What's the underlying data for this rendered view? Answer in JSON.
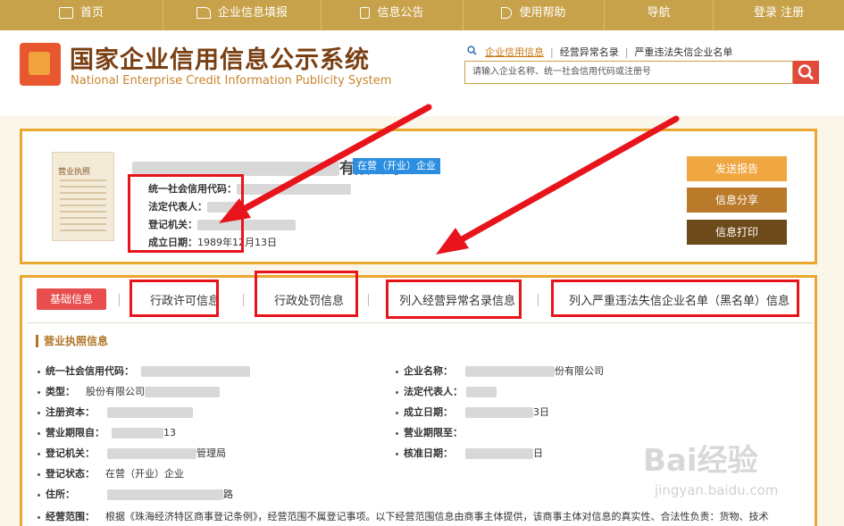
{
  "nav": {
    "home": "首页",
    "fill": "企业信息填报",
    "notice": "信息公告",
    "help": "使用帮助",
    "guide": "导航",
    "login": "登录",
    "register": "注册"
  },
  "brand": {
    "title_cn": "国家企业信用信息公示系统",
    "title_en": "National Enterprise Credit Information Publicity System"
  },
  "quick_links": [
    "企业信用信息",
    "经营异常名录",
    "严重违法失信企业名单"
  ],
  "search": {
    "placeholder": "请输入企业名称、统一社会信用代码或注册号"
  },
  "license": {
    "label": "营业执照"
  },
  "company": {
    "name_suffix": "有限公司",
    "status": "在营（开业）企业",
    "credit_code_label": "统一社会信用代码：",
    "legal_rep_label": "法定代表人：",
    "reg_authority_label": "登记机关：",
    "founded_label": "成立日期：",
    "founded_value": "1989年12月13日"
  },
  "actions": {
    "report": "发送报告",
    "share": "信息分享",
    "print": "信息打印"
  },
  "tabs": [
    "基础信息",
    "行政许可信息",
    "行政处罚信息",
    "列入经营异常名录信息",
    "列入严重违法失信企业名单（黑名单）信息"
  ],
  "section": {
    "title": "营业执照信息",
    "left": [
      {
        "label": "统一社会信用代码：",
        "value": ""
      },
      {
        "label": "类型：",
        "value": "股份有限公司"
      },
      {
        "label": "注册资本：",
        "value": ""
      },
      {
        "label": "营业期限自：",
        "value": "13"
      },
      {
        "label": "登记机关：",
        "value": "管理局"
      },
      {
        "label": "登记状态：",
        "value": "在营（开业）企业"
      },
      {
        "label": "住所：",
        "value": "路"
      }
    ],
    "right": [
      {
        "label": "企业名称：",
        "value": "份有限公司"
      },
      {
        "label": "法定代表人：",
        "value": ""
      },
      {
        "label": "成立日期：",
        "value": "3日"
      },
      {
        "label": "营业期限至：",
        "value": ""
      },
      {
        "label": "核准日期：",
        "value": "日"
      }
    ],
    "scope_label": "经营范围：",
    "scope_text": "根据《珠海经济特区商事登记条例》，经营范围不属登记事项。以下经营范围信息由商事主体提供，该商事主体对信息的真实性、合法性负责：货物、技术"
  },
  "watermark": {
    "main": "Bai经验",
    "sub": "jingyan.baidu.com"
  },
  "colors": {
    "nav": "#c8a24a",
    "accent": "#e9a72d",
    "red": "#e8141c",
    "chip": "#2b8ee0"
  }
}
